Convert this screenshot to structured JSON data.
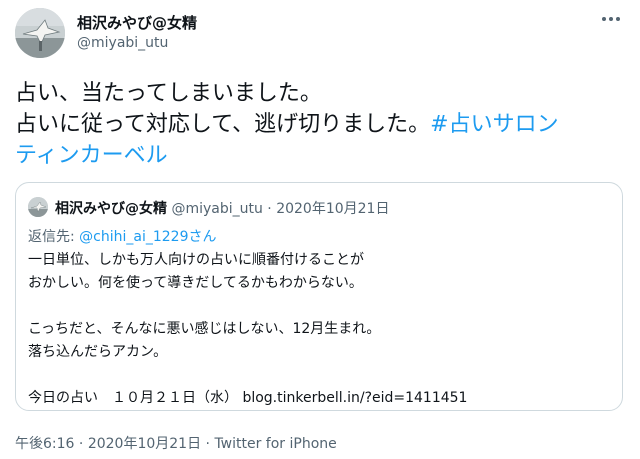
{
  "author": {
    "display_name": "相沢みやび@女精",
    "handle": "@miyabi_utu",
    "avatar": "avatar-photo"
  },
  "more_icon": "more-horizontal-icon",
  "tweet": {
    "line1": "占い、当たってしまいました。",
    "line2_text": "占いに従って対応して、逃げ切りました。",
    "line2_hashtag": "#占いサロン",
    "line3_hashtag": "ティンカーベル"
  },
  "quote": {
    "author_name": "相沢みやび@女精",
    "author_meta": "@miyabi_utu · 2020年10月21日",
    "reply_prefix": "返信先: ",
    "reply_mention": "@chihi_ai_1229さん",
    "body_lines": [
      "一日単位、しかも万人向けの占いに順番付けることが",
      "おかしい。何を使って導きだしてるかもわからない。",
      "",
      "こっちだと、そんなに悪い感じはしない、12月生まれ。",
      "落ち込んだらアカン。",
      "",
      "今日の占い　１０月２１日（水） blog.tinkerbell.in/?eid=1411451"
    ]
  },
  "footer": {
    "time": "午後6:16",
    "separator1": " · ",
    "date": "2020年10月21日",
    "separator2": " · ",
    "source": "Twitter for iPhone"
  },
  "colors": {
    "text": "#0f1419",
    "secondary": "#536471",
    "link": "#1d9bf0",
    "border": "#cfd9de"
  }
}
